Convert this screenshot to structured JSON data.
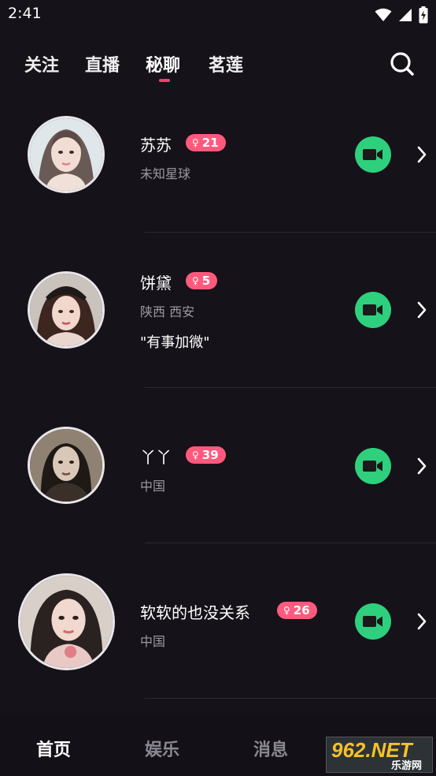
{
  "status_bar": {
    "time": "2:41"
  },
  "top_tabs": [
    {
      "label": "关注"
    },
    {
      "label": "直播"
    },
    {
      "label": "秘聊"
    },
    {
      "label": "茗莲"
    }
  ],
  "active_top_tab": "秘聊",
  "users": [
    {
      "name": "苏苏",
      "level": "21",
      "location": "未知星球",
      "signature": ""
    },
    {
      "name": "饼黛",
      "level": "5",
      "location": "陕西 西安",
      "signature": "\"有事加微\""
    },
    {
      "name": "丫丫",
      "level": "39",
      "location": "中国",
      "signature": ""
    },
    {
      "name": "软软的也没关系",
      "level": "26",
      "location": "中国",
      "signature": ""
    }
  ],
  "bottom_tabs": [
    {
      "label": "首页"
    },
    {
      "label": "娱乐"
    },
    {
      "label": "消息"
    }
  ],
  "active_bottom_tab": "首页",
  "watermark": {
    "big": "962.NET",
    "small": "乐游网"
  },
  "colors": {
    "background": "#161219",
    "accent": "#ff3b6b",
    "badge": "#ff5a7e",
    "video_button": "#2fd07d"
  }
}
